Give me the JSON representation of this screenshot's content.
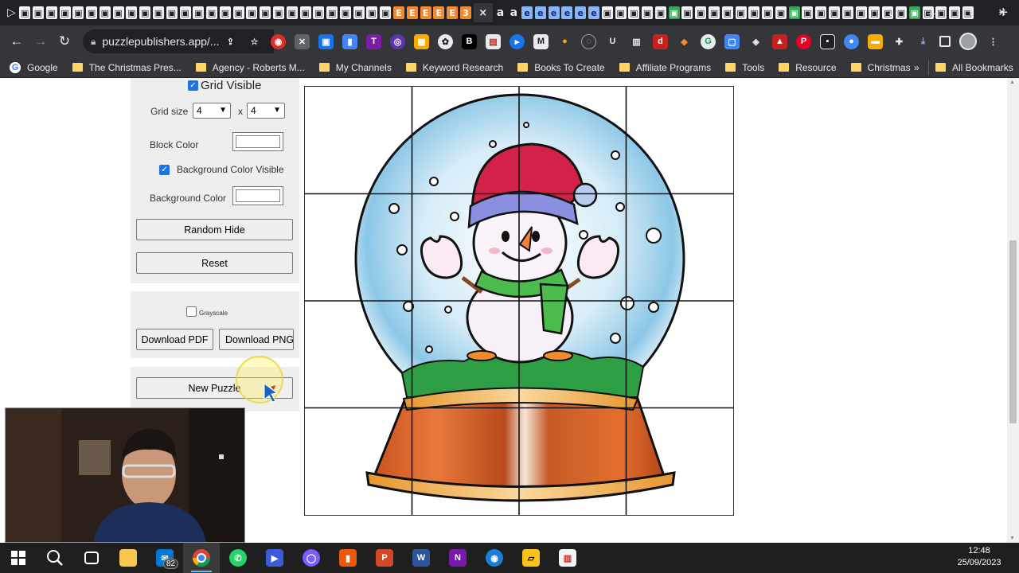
{
  "browser": {
    "tab_glyphs": [
      "▷",
      "▣",
      "▣",
      "▣",
      "▣",
      "▣",
      "▣",
      "▣",
      "▣",
      "▣",
      "▣",
      "▣",
      "▣",
      "▣",
      "▣",
      "▣",
      "▣",
      "▣",
      "▣",
      "▣",
      "▣",
      "▣",
      "▣",
      "▣",
      "▣",
      "▣",
      "▣",
      "▣",
      "▣",
      "E",
      "E",
      "E",
      "E",
      "E",
      "3"
    ],
    "active_tab_close": "×",
    "tab_glyphs_after": [
      "a",
      "a",
      "e",
      "e",
      "e",
      "e",
      "e",
      "e",
      "▣",
      "▣",
      "▣",
      "▣",
      "▣",
      "▣",
      "▣",
      "▣",
      "▣",
      "▣",
      "▣",
      "▣",
      "▣",
      "▣",
      "▣",
      "▣",
      "▣",
      "▣",
      "▣",
      "▣",
      "▣",
      "▣",
      "▣",
      "▣",
      "▣",
      "▣",
      "▣",
      "▣"
    ],
    "new_tab": "+",
    "url": "puzzlepublishers.app/...",
    "profile_icon": "avatar-icon"
  },
  "bookmarks": {
    "items": [
      "Google",
      "The Christmas Pres...",
      "Agency - Roberts M...",
      "My Channels",
      "Keyword Research",
      "Books To Create",
      "Affiliate Programs",
      "Tools",
      "Resource",
      "Christmas"
    ],
    "more": "»",
    "all_bookmarks": "All Bookmarks"
  },
  "controls": {
    "grid_visible_label": "Grid Visible",
    "grid_size_label": "Grid size",
    "grid_rows": "4",
    "grid_x": "x",
    "grid_cols": "4",
    "block_color_label": "Block Color",
    "block_color": "#ffffff",
    "bg_visible_label": "Background Color Visible",
    "bg_color_label": "Background Color",
    "bg_color": "#ffffff",
    "random_hide": "Random Hide",
    "reset": "Reset",
    "grayscale_label": "Grayscale",
    "download_pdf": "Download PDF",
    "download_png": "Download PNG",
    "new_puzzle": "New Puzzle"
  },
  "puzzle": {
    "grid": [
      4,
      4
    ],
    "image": "snow globe with snowman"
  },
  "taskbar": {
    "mail_badge": "82",
    "time": "12:48",
    "date": "25/09/2023"
  }
}
